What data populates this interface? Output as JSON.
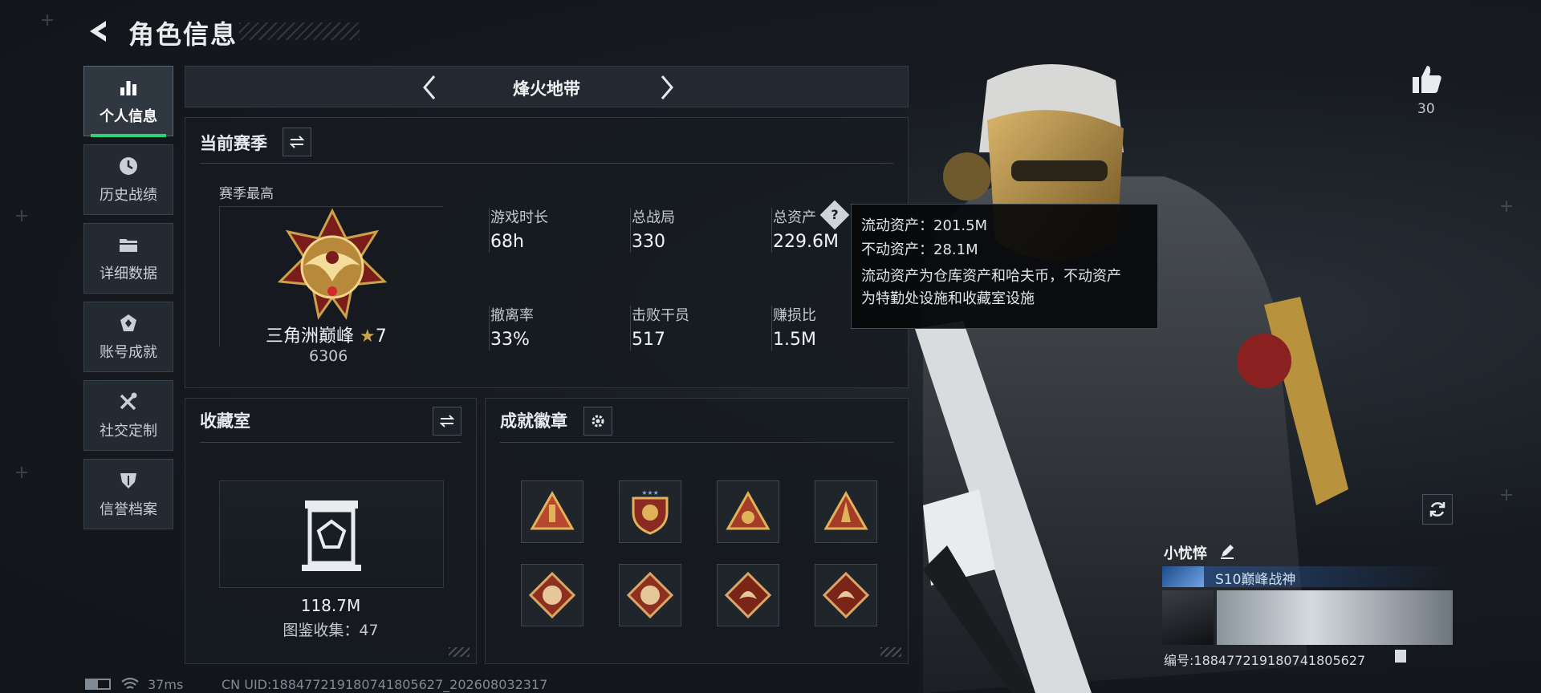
{
  "header": {
    "title": "角色信息"
  },
  "sidebar": {
    "items": [
      {
        "label": "个人信息",
        "icon": "bar-chart-icon",
        "active": true
      },
      {
        "label": "历史战绩",
        "icon": "clock-icon"
      },
      {
        "label": "详细数据",
        "icon": "folder-icon"
      },
      {
        "label": "账号成就",
        "icon": "achievement-icon"
      },
      {
        "label": "社交定制",
        "icon": "tools-icon"
      },
      {
        "label": "信誉档案",
        "icon": "shield-icon"
      }
    ]
  },
  "mode": {
    "name": "烽火地带"
  },
  "season": {
    "title": "当前赛季",
    "highest_label": "赛季最高",
    "rank_name": "三角洲巅峰",
    "rank_stars": "7",
    "rank_points": "6306",
    "stats": [
      {
        "label": "游戏时长",
        "value": "68h"
      },
      {
        "label": "总战局",
        "value": "330"
      },
      {
        "label": "总资产",
        "value": "229.6M"
      },
      {
        "label": "撤离率",
        "value": "33%"
      },
      {
        "label": "击败干员",
        "value": "517"
      },
      {
        "label": "赚损比",
        "value": "1.5M"
      }
    ],
    "help_glyph": "?"
  },
  "tooltip": {
    "line1": "流动资产：201.5M",
    "line2": "不动资产：28.1M",
    "desc1": "流动资产为仓库资产和哈夫币，不动资产",
    "desc2": "为特勤处设施和收藏室设施"
  },
  "collection": {
    "title": "收藏室",
    "value": "118.7M",
    "count": "图鉴收集：47"
  },
  "badges": {
    "title": "成就徽章",
    "items": [
      "triangle-badge-icon",
      "shield-emblem-badge-icon",
      "triangle-badge-icon",
      "triangle-badge-icon",
      "wolf-badge-icon",
      "wolf-badge-icon",
      "dragon-badge-icon",
      "dragon-badge-icon"
    ]
  },
  "likes": {
    "count": "30"
  },
  "profile": {
    "name": "小忧悴",
    "title_badge": "S10巅峰战神",
    "id_text": "编号:18847721918074180562​7"
  },
  "status": {
    "ping": "37ms",
    "uid": "CN UID:18847721918074180562​7_202608032317"
  },
  "colors": {
    "accent": "#2bd47a",
    "gold": "#c9a24a"
  }
}
